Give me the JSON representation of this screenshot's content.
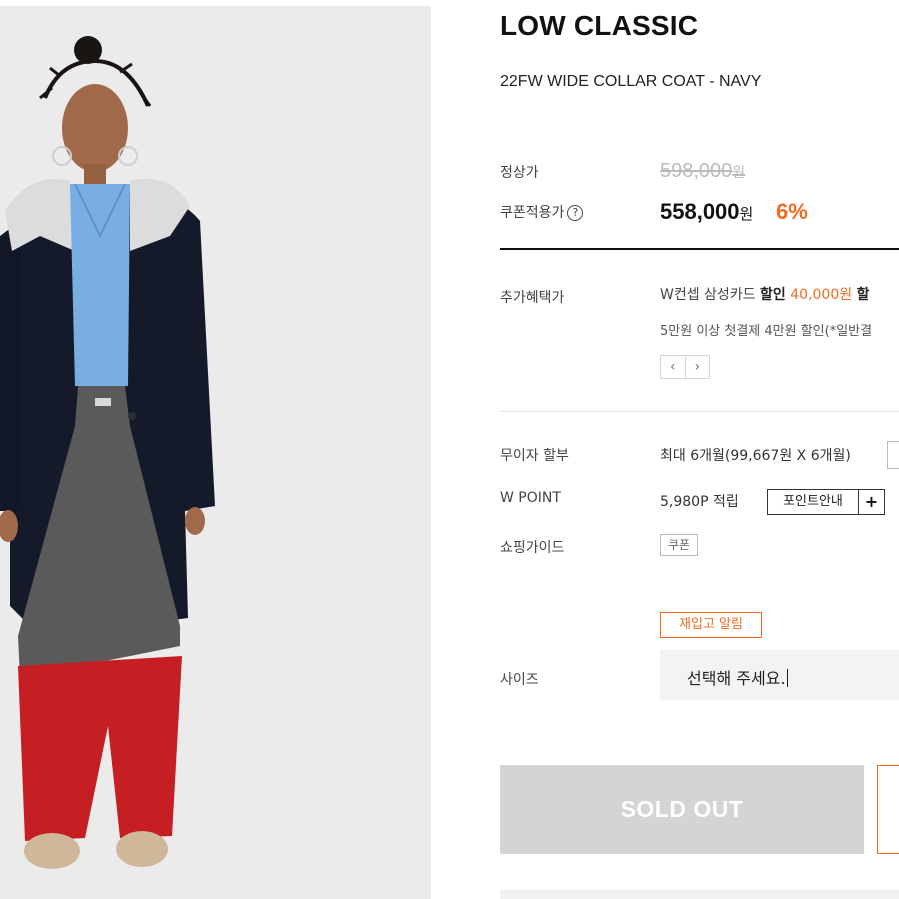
{
  "product": {
    "brand": "LOW CLASSIC",
    "name": "22FW WIDE COLLAR COAT - NAVY"
  },
  "price": {
    "regular_label": "정상가",
    "regular_value": "598,000",
    "regular_unit": "원",
    "coupon_label": "쿠폰적용가",
    "coupon_value": "558,000",
    "coupon_unit": "원",
    "discount": "6%",
    "help_icon": "?"
  },
  "benefits": {
    "label": "추가혜택가",
    "line1_prefix": "W컨셉 삼성카드 ",
    "line1_bold": "할인",
    "line1_amount": "40,000원",
    "line1_suffix": "할",
    "line2": "5만원 이상 첫결제 4만원 할인(*일반결",
    "prev": "‹",
    "next": "›"
  },
  "installment": {
    "label": "무이자 할부",
    "value": "최대 6개월(99,667원 X 6개월)"
  },
  "wpoint": {
    "label": "W POINT",
    "value": "5,980P 적립",
    "guide_button": "포인트안내",
    "plus_button": "+"
  },
  "shopping_guide": {
    "label": "쇼핑가이드",
    "coupon_button": "쿠폰"
  },
  "size": {
    "restock_button": "재입고 알림",
    "label": "사이즈",
    "placeholder": "선택해 주세요."
  },
  "actions": {
    "sold_out": "SOLD OUT"
  },
  "colors": {
    "accent": "#f26b21",
    "sold_out_bg": "#d4d4d4",
    "photo_bg": "#ebebec"
  }
}
